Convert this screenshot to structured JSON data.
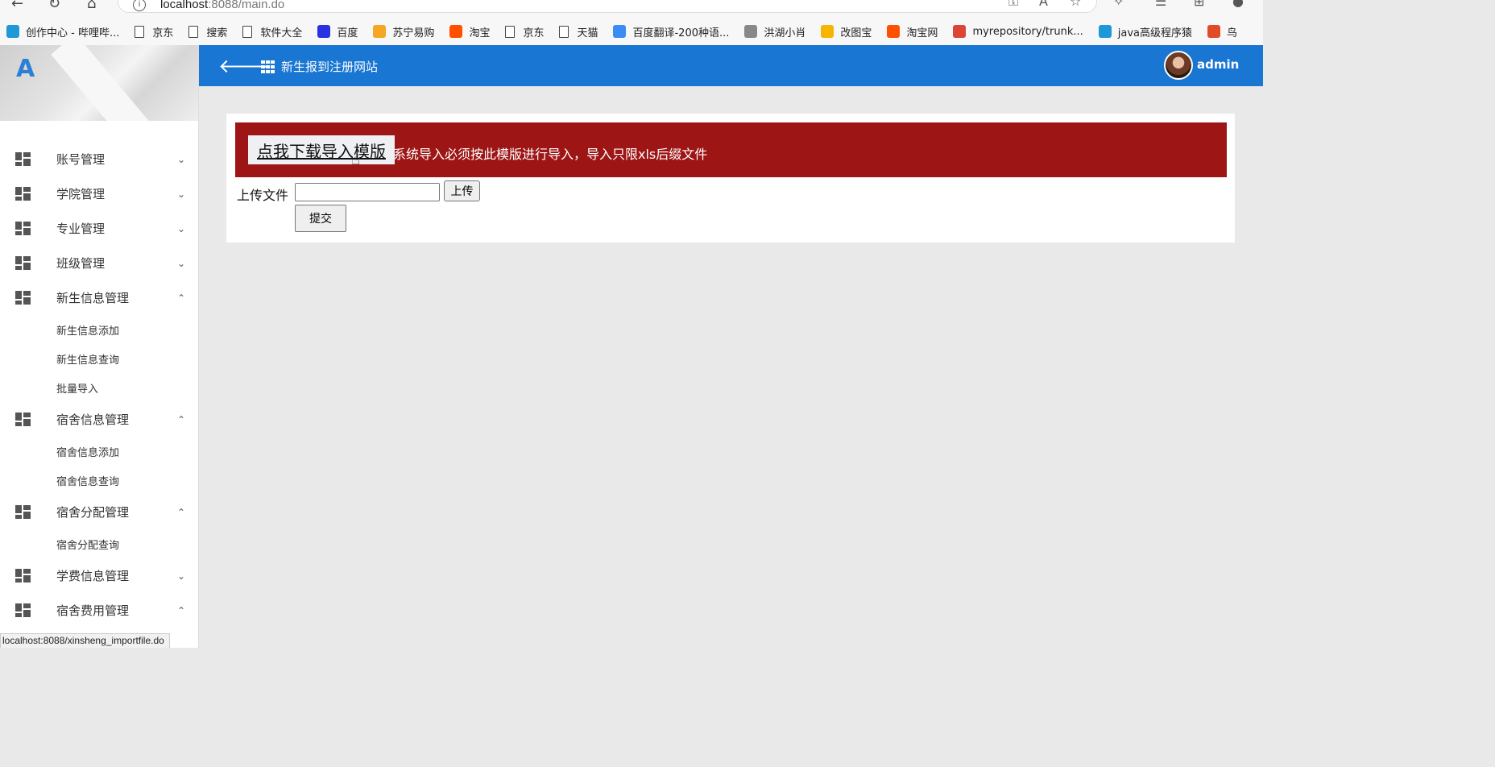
{
  "browser": {
    "url_host": "localhost",
    "url_path": ":8088/main.do",
    "status_url": "localhost:8088/xinsheng_importfile.do",
    "bookmarks": [
      {
        "label": "创作中心 - 哔哩哔...",
        "icon": "bilibili-icon",
        "color": "#1e98d7"
      },
      {
        "label": "京东",
        "icon": "page-icon"
      },
      {
        "label": "搜索",
        "icon": "page-icon"
      },
      {
        "label": "软件大全",
        "icon": "page-icon"
      },
      {
        "label": "百度",
        "icon": "baidu-icon",
        "color": "#2932e1"
      },
      {
        "label": "苏宁易购",
        "icon": "suning-icon",
        "color": "#f5a623"
      },
      {
        "label": "淘宝",
        "icon": "taobao-icon",
        "color": "#ff5000"
      },
      {
        "label": "京东",
        "icon": "page-icon"
      },
      {
        "label": "天猫",
        "icon": "page-icon"
      },
      {
        "label": "百度翻译-200种语...",
        "icon": "fanyi-icon",
        "color": "#3b8cf5"
      },
      {
        "label": "洪湖小肖",
        "icon": "avatar-icon",
        "color": "#888888"
      },
      {
        "label": "改图宝",
        "icon": "gaitubao-icon",
        "color": "#f7b500"
      },
      {
        "label": "淘宝网",
        "icon": "taobao-icon",
        "color": "#ff5000"
      },
      {
        "label": "myrepository/trunk...",
        "icon": "chrome-icon",
        "color": "#db4437"
      },
      {
        "label": "java高级程序猿",
        "icon": "bilibili-icon",
        "color": "#1e98d7"
      },
      {
        "label": "鸟",
        "icon": "bird-icon",
        "color": "#e04b2a"
      }
    ]
  },
  "header": {
    "site_title": "新生报到注册网站",
    "username": "admin",
    "color": "#1976d2"
  },
  "sidebar": {
    "logo": "A",
    "items": [
      {
        "label": "账号管理",
        "expanded": false,
        "chevron": "⌄",
        "subs": []
      },
      {
        "label": "学院管理",
        "expanded": false,
        "chevron": "⌄",
        "subs": []
      },
      {
        "label": "专业管理",
        "expanded": false,
        "chevron": "⌄",
        "subs": []
      },
      {
        "label": "班级管理",
        "expanded": false,
        "chevron": "⌄",
        "subs": []
      },
      {
        "label": "新生信息管理",
        "expanded": true,
        "chevron": "⌃",
        "subs": [
          "新生信息添加",
          "新生信息查询",
          "批量导入"
        ]
      },
      {
        "label": "宿舍信息管理",
        "expanded": true,
        "chevron": "⌃",
        "subs": [
          "宿舍信息添加",
          "宿舍信息查询"
        ]
      },
      {
        "label": "宿舍分配管理",
        "expanded": true,
        "chevron": "⌃",
        "subs": [
          "宿舍分配查询"
        ]
      },
      {
        "label": "学费信息管理",
        "expanded": false,
        "chevron": "⌄",
        "subs": []
      },
      {
        "label": "宿舍费用管理",
        "expanded": true,
        "chevron": "⌃",
        "subs": []
      }
    ]
  },
  "main": {
    "download_label": "点我下载导入模版",
    "notice": "系统导入必须按此模版进行导入，导入只限xls后缀文件",
    "notice_color": "#9e1515",
    "upload_label": "上传文件",
    "upload_button": "上传",
    "submit_button": "提交"
  }
}
